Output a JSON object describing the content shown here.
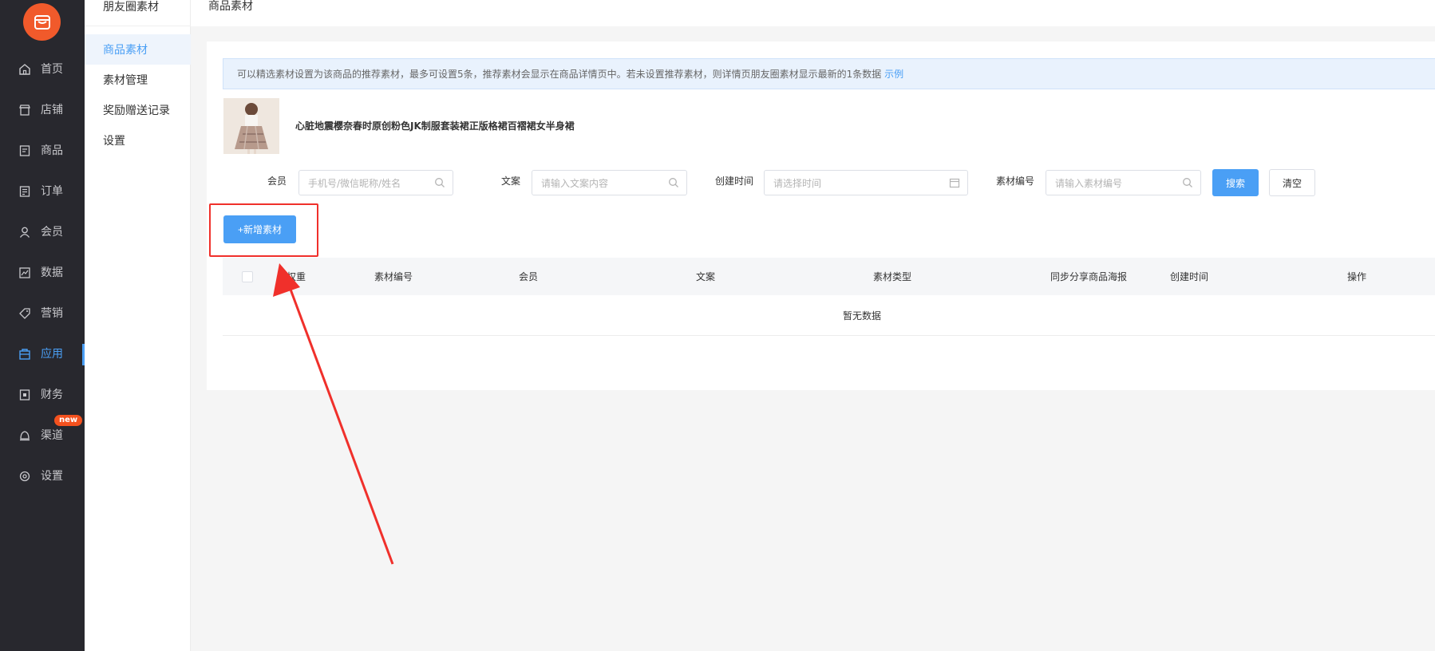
{
  "nav": {
    "items": [
      {
        "label": "首页",
        "icon": "home-icon"
      },
      {
        "label": "店铺",
        "icon": "store-icon"
      },
      {
        "label": "商品",
        "icon": "goods-icon"
      },
      {
        "label": "订单",
        "icon": "order-icon"
      },
      {
        "label": "会员",
        "icon": "user-icon"
      },
      {
        "label": "数据",
        "icon": "chart-icon"
      },
      {
        "label": "营销",
        "icon": "tag-icon"
      },
      {
        "label": "应用",
        "icon": "app-icon",
        "active": true
      },
      {
        "label": "财务",
        "icon": "finance-icon"
      },
      {
        "label": "渠道",
        "icon": "channel-icon",
        "badge": "new"
      },
      {
        "label": "设置",
        "icon": "gear-icon"
      }
    ],
    "accent": "#4a9ff5",
    "logo_color": "#f15a2b"
  },
  "subnav": {
    "title": "朋友圈素材",
    "items": [
      {
        "label": "商品素材",
        "active": true
      },
      {
        "label": "素材管理"
      },
      {
        "label": "奖励赠送记录"
      },
      {
        "label": "设置"
      }
    ]
  },
  "header": {
    "breadcrumb": "商品素材"
  },
  "notice": {
    "text": "可以精选素材设置为该商品的推荐素材，最多可设置5条，推荐素材会显示在商品详情页中。若未设置推荐素材，则详情页朋友圈素材显示最新的1条数据",
    "link": "示例"
  },
  "product": {
    "title": "心脏地震樱奈春时原创粉色JK制服套装裙正版格裙百褶裙女半身裙"
  },
  "filters": {
    "member_label": "会员",
    "member_placeholder": "手机号/微信昵称/姓名",
    "copy_label": "文案",
    "copy_placeholder": "请输入文案内容",
    "time_label": "创建时间",
    "time_placeholder": "请选择时间",
    "code_label": "素材编号",
    "code_placeholder": "请输入素材编号",
    "search_button": "搜索",
    "clear_button": "清空"
  },
  "actions": {
    "add_button": "+新增素材"
  },
  "table": {
    "headers": [
      "权重",
      "素材编号",
      "会员",
      "文案",
      "素材类型",
      "同步分享商品海报",
      "创建时间",
      "操作"
    ],
    "empty": "暂无数据"
  },
  "annotation_color": "#f0302b"
}
